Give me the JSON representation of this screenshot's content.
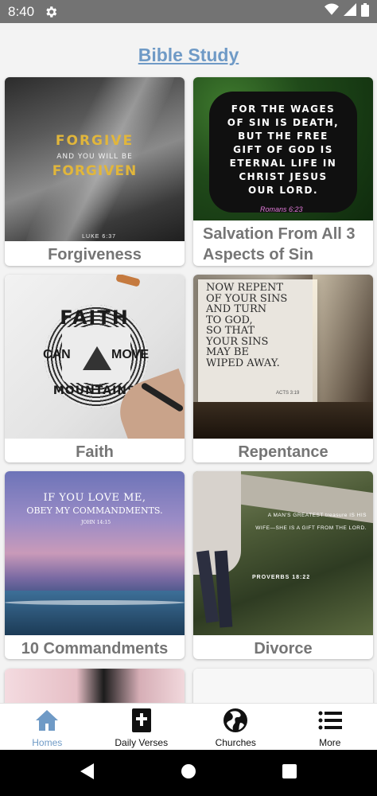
{
  "status_bar": {
    "time": "8:40"
  },
  "header": {
    "title": "Bible Study"
  },
  "cards": [
    {
      "label": "Forgiveness",
      "image_text": {
        "line1": "FORGIVE",
        "line2": "AND YOU WILL BE",
        "line3": "FORGIVEN",
        "ref": "LUKE 6:37"
      }
    },
    {
      "label": "Salvation From All 3 Aspects of Sin",
      "image_text": {
        "lines": [
          "FOR THE WAGES",
          "OF SIN IS DEATH,",
          "BUT THE FREE",
          "GIFT OF GOD IS",
          "ETERNAL LIFE IN",
          "CHRIST JESUS",
          "OUR LORD."
        ],
        "ref": "Romans 6:23"
      }
    },
    {
      "label": "Faith",
      "image_text": {
        "top": "FAITH",
        "left": "CAN",
        "right": "MOVE",
        "bottom": "MOUNTAINS"
      }
    },
    {
      "label": "Repentance",
      "image_text": {
        "lines": [
          "NOW REPENT",
          "OF YOUR SINS",
          "AND TURN",
          "TO GOD,",
          "SO THAT",
          "YOUR SINS",
          "MAY BE",
          "WIPED AWAY."
        ],
        "ref": "ACTS 3:19"
      }
    },
    {
      "label": "10 Commandments",
      "image_text": {
        "line1": "IF YOU LOVE ME,",
        "line2": "OBEY MY COMMANDMENTS.",
        "ref": "JOHN 14:15"
      }
    },
    {
      "label": "Divorce",
      "image_text": {
        "line1": "A MAN'S GREATEST treasure IS HIS",
        "line2": "WIFE—SHE IS A GIFT FROM THE LORD.",
        "ref": "PROVERBS 18:22"
      }
    }
  ],
  "bottom_nav": [
    {
      "label": "Homes",
      "icon": "home-icon",
      "active": true
    },
    {
      "label": "Daily Verses",
      "icon": "bible-icon",
      "active": false
    },
    {
      "label": "Churches",
      "icon": "globe-icon",
      "active": false
    },
    {
      "label": "More",
      "icon": "menu-icon",
      "active": false
    }
  ],
  "colors": {
    "accent": "#6f9ac6",
    "label_gray": "#757575",
    "status_bar": "#737373"
  }
}
